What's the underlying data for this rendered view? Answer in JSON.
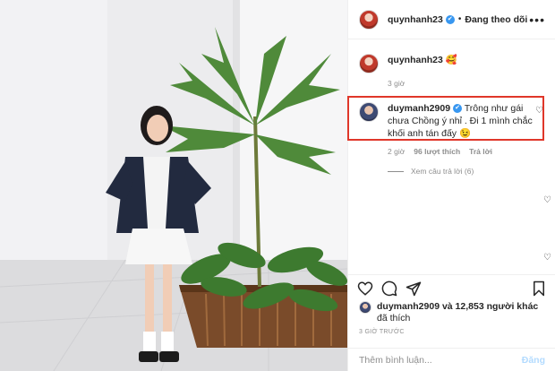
{
  "header": {
    "username": "quynhanh23",
    "verified_glyph": "✔",
    "separator": "•",
    "follow_status": "Đang theo dõi",
    "more_glyph": "•••"
  },
  "caption": {
    "username": "quynhanh23",
    "text": "🥰",
    "time": "3 giờ"
  },
  "comment": {
    "username": "duymanh2909",
    "text": "Trông như gái chưa Chồng ý nhỉ . Đi 1 mình chắc khối anh tán đấy 😉",
    "time": "2 giờ",
    "likes": "96 lượt thích",
    "reply": "Trả lời",
    "view_replies": "Xem câu trả lời (6)"
  },
  "likes_summary": {
    "username": "duymanh2909",
    "rest": "và 12,853 người khác",
    "second_line": "đã thích"
  },
  "posted_ago": "3 GIỜ TRƯỚC",
  "composer": {
    "placeholder": "Thêm bình luận...",
    "post_label": "Đăng"
  },
  "icons": {
    "comment_like": "heart-outline-icon",
    "like": "heart-outline-icon",
    "comment": "speech-bubble-icon",
    "share": "paper-plane-icon",
    "save": "bookmark-icon"
  },
  "colors": {
    "highlight_border": "#e0372a",
    "verified": "#3897f0",
    "muted_text": "#8e8e8e",
    "post_button_disabled": "#b3dbff"
  }
}
